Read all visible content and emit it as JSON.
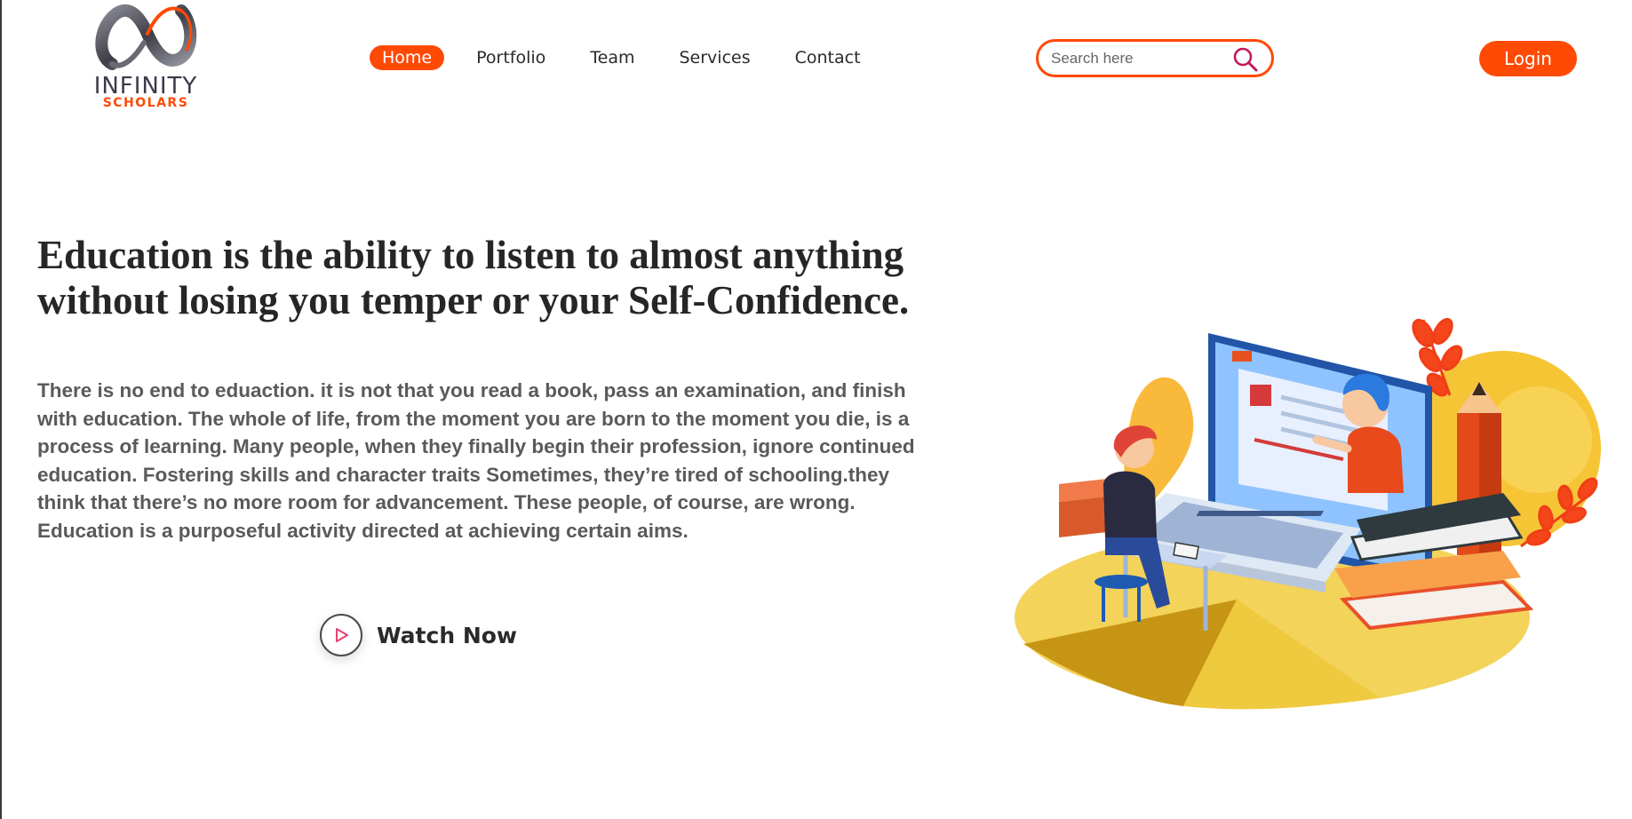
{
  "brand": {
    "name": "INFINITY",
    "sub": "SCHOLARS",
    "colors": {
      "accent": "#ff4a06",
      "logo_gray": "#5a5a66"
    }
  },
  "nav": {
    "items": [
      {
        "label": "Home",
        "active": true
      },
      {
        "label": "Portfolio",
        "active": false
      },
      {
        "label": "Team",
        "active": false
      },
      {
        "label": "Services",
        "active": false
      },
      {
        "label": "Contact",
        "active": false
      }
    ]
  },
  "search": {
    "placeholder": "Search here",
    "value": "",
    "icon": "search-icon"
  },
  "login": {
    "label": "Login"
  },
  "hero": {
    "headline_line1": "Education is the ability to listen to almost anything",
    "headline_line2": "without losing you temper or your Self-Confidence.",
    "paragraph_lines": [
      "There is no end to eduaction. it is not that you read a book, pass an examination, and finish",
      "with education. The whole of life, from the moment you are born to the moment you die, is a",
      "process of learning. Many people, when they finally begin their profession, ignore continued",
      "education. Fostering skills and character traits Sometimes, they’re tired of schooling.they",
      "think that there’s no more room for advancement. These people, of course, are wrong.",
      "Education is a purposeful activity directed at achieving certain aims."
    ],
    "watch_label": "Watch Now",
    "watch_icon": "play-icon"
  }
}
